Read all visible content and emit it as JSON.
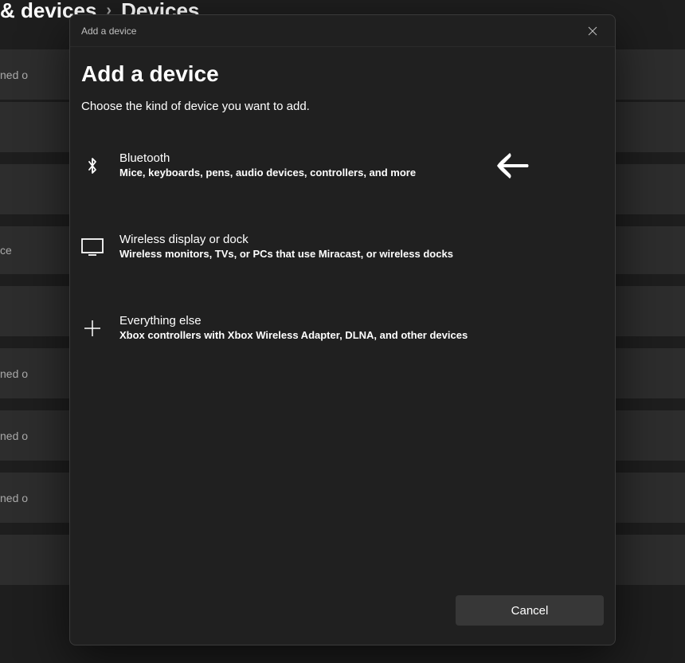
{
  "background": {
    "breadcrumb_part1": "& devices",
    "breadcrumb_part2": "Devices",
    "row_text_partial": "ned o",
    "row_text_short": "ce"
  },
  "modal": {
    "titlebar": "Add a device",
    "heading": "Add a device",
    "subtext": "Choose the kind of device you want to add.",
    "options": [
      {
        "title": "Bluetooth",
        "desc": "Mice, keyboards, pens, audio devices, controllers, and more"
      },
      {
        "title": "Wireless display or dock",
        "desc": "Wireless monitors, TVs, or PCs that use Miracast, or wireless docks"
      },
      {
        "title": "Everything else",
        "desc": "Xbox controllers with Xbox Wireless Adapter, DLNA, and other devices"
      }
    ],
    "cancel_label": "Cancel"
  }
}
